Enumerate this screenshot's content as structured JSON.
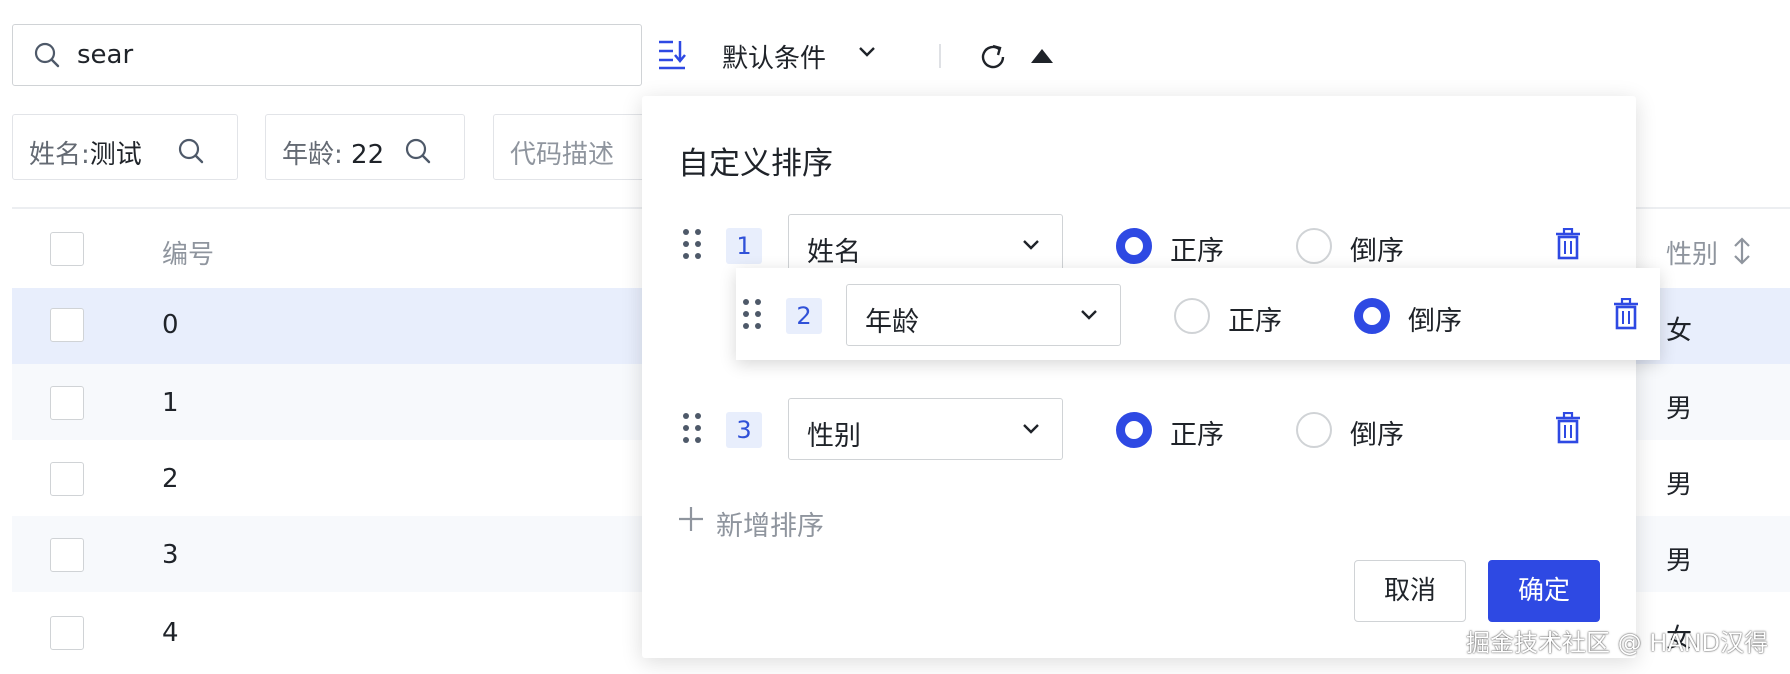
{
  "toolbar": {
    "search_value": "sear",
    "condition_label": "默认条件"
  },
  "filters": {
    "name_key": "姓名:",
    "name_value": "测试",
    "age_key": "年龄:",
    "age_value": "22",
    "code_placeholder": "代码描述"
  },
  "table": {
    "headers": {
      "no": "编号",
      "sex": "性别"
    },
    "rows": [
      {
        "no": "0",
        "sex": "女"
      },
      {
        "no": "1",
        "sex": "男"
      },
      {
        "no": "2",
        "sex": "男"
      },
      {
        "no": "3",
        "sex": "男"
      },
      {
        "no": "4",
        "sex": "女"
      }
    ]
  },
  "sort_panel": {
    "title": "自定义排序",
    "rows": [
      {
        "index": "1",
        "field": "姓名",
        "asc_label": "正序",
        "desc_label": "倒序",
        "selected": "asc"
      },
      {
        "index": "2",
        "field": "年龄",
        "asc_label": "正序",
        "desc_label": "倒序",
        "selected": "desc"
      },
      {
        "index": "3",
        "field": "性别",
        "asc_label": "正序",
        "desc_label": "倒序",
        "selected": "asc"
      }
    ],
    "add_label": "新增排序",
    "cancel_label": "取消",
    "confirm_label": "确定"
  },
  "watermark": "掘金技术社区 @ HAND汉得",
  "colors": {
    "primary": "#2e49e3",
    "selected_row": "#e8eefc",
    "alt_row": "#f7f9fc",
    "border": "#d0d3d6"
  }
}
